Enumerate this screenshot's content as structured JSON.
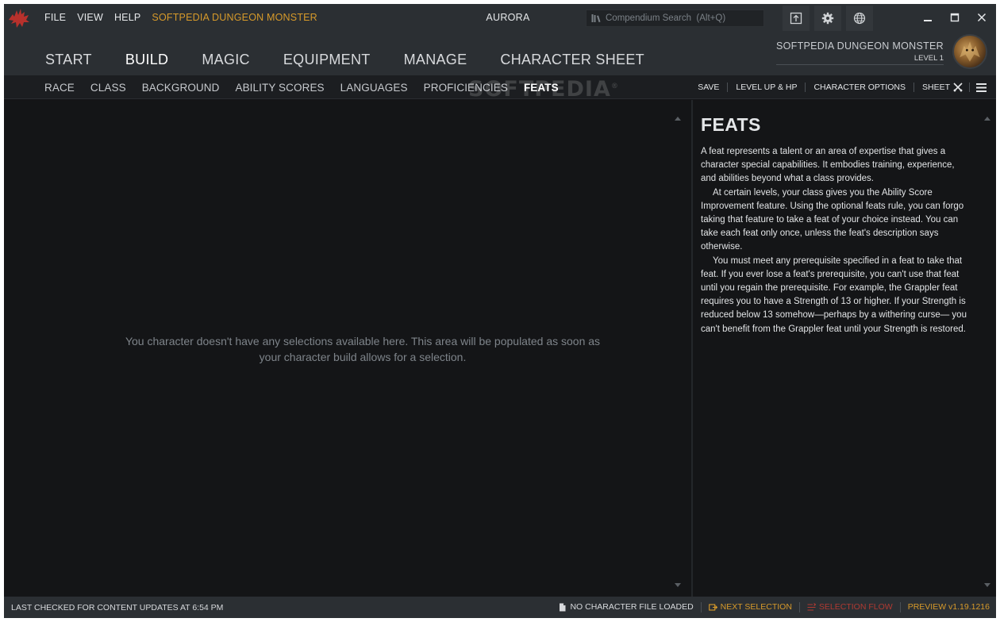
{
  "menubar": {
    "items": [
      "FILE",
      "VIEW",
      "HELP"
    ],
    "character_name": "SOFTPEDIA DUNGEON MONSTER"
  },
  "app_title": "AURORA",
  "search": {
    "placeholder": "Compendium Search  (Alt+Q)"
  },
  "main_nav": {
    "tabs": [
      "START",
      "BUILD",
      "MAGIC",
      "EQUIPMENT",
      "MANAGE",
      "CHARACTER SHEET"
    ],
    "active": "BUILD"
  },
  "character": {
    "name": "SOFTPEDIA DUNGEON MONSTER",
    "level": "LEVEL 1"
  },
  "build_tabs": {
    "tabs": [
      "RACE",
      "CLASS",
      "BACKGROUND",
      "ABILITY SCORES",
      "LANGUAGES",
      "PROFICIENCIES",
      "FEATS"
    ],
    "active": "FEATS"
  },
  "watermark": "SOFTPEDIA",
  "watermark_mark": "®",
  "build_actions": {
    "save": "SAVE",
    "level_up": "LEVEL UP & HP",
    "character_options": "CHARACTER OPTIONS",
    "sheet": "SHEET"
  },
  "selection_pane": {
    "empty_message": "You character doesn't have any selections available here. This area will be populated as soon as your character build allows for a selection."
  },
  "description": {
    "title": "FEATS",
    "paragraphs": [
      "A feat represents a talent or an area of expertise that gives a character special capabilities. It embodies training, experience, and abilities beyond what a class provides.",
      "At certain levels, your class gives you the Ability Score Improvement feature. Using the optional feats rule, you can forgo taking that feature to take a feat of your choice instead. You can take each feat only once, unless the feat's description says otherwise.",
      "You must meet any prerequisite specified in a feat to take that feat. If you ever lose a feat's prerequisite, you can't use that feat until you regain the prerequisite. For example, the Grappler feat requires you to have a Strength of 13 or higher. If your Strength is reduced below 13 somehow—perhaps by a withering curse— you can't benefit from the Grappler feat until your Strength is restored."
    ]
  },
  "statusbar": {
    "last_checked": "LAST CHECKED FOR CONTENT UPDATES AT 6:54 PM",
    "file_status": "NO CHARACTER FILE LOADED",
    "next_selection": "NEXT SELECTION",
    "selection_flow": "SELECTION FLOW",
    "version": "PREVIEW v1.19.1216"
  },
  "icons": {
    "app": "dragon-logo-icon",
    "search": "books-icon",
    "toolbar": [
      "upload-icon",
      "gear-icon",
      "globe-icon"
    ],
    "window": [
      "minimize-icon",
      "maximize-icon",
      "close-icon"
    ]
  },
  "colors": {
    "accent": "#d79a2a",
    "flow_red": "#b03a32",
    "logo_red": "#b8312c",
    "header_bg": "#2b2f33",
    "content_bg": "#141517"
  }
}
